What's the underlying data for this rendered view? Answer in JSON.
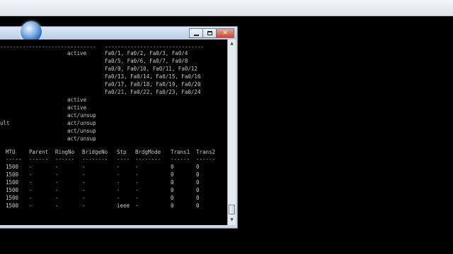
{
  "window": {
    "caption_close": "✕"
  },
  "console": {
    "dash_lines": [
      "-------------------------",
      "---------",
      "-------------------------------"
    ],
    "vlan_rows": [
      {
        "name": "",
        "status": "active",
        "ports": "Fa0/1, Fa0/2, Fa0/3, Fa0/4"
      },
      {
        "name": "",
        "status": "",
        "ports": "Fa0/5, Fa0/6, Fa0/7, Fa0/8"
      },
      {
        "name": "",
        "status": "",
        "ports": "Fa0/9, Fa0/10, Fa0/11, Fa0/12"
      },
      {
        "name": "",
        "status": "",
        "ports": "Fa0/13, Fa0/14, Fa0/15, Fa0/16"
      },
      {
        "name": "",
        "status": "",
        "ports": "Fa0/17, Fa0/18, Fa0/19, Fa0/20"
      },
      {
        "name": "",
        "status": "",
        "ports": "Fa0/21, Fa0/22, Fa0/23, Fa0/24"
      },
      {
        "name": "",
        "status": "active",
        "ports": ""
      },
      {
        "name": "",
        "status": "active",
        "ports": ""
      },
      {
        "name": "",
        "status": "act/unsup",
        "ports": ""
      },
      {
        "name": "ult",
        "status": "act/unsup",
        "ports": ""
      },
      {
        "name": "",
        "status": "act/unsup",
        "ports": ""
      },
      {
        "name": "",
        "status": "act/unsup",
        "ports": ""
      }
    ],
    "headers": [
      "MTU",
      "Parent",
      "RingNo",
      "BridgeNo",
      "Stp",
      "BrdgMode",
      "Trans1",
      "Trans2"
    ],
    "header_dashes": [
      "-----",
      "------",
      "------",
      "--------",
      "----",
      "--------",
      "------",
      "------"
    ],
    "rows": [
      [
        "1500",
        "-",
        "-",
        "-",
        "-",
        "-",
        "0",
        "0"
      ],
      [
        "1500",
        "-",
        "-",
        "-",
        "-",
        "-",
        "0",
        "0"
      ],
      [
        "1500",
        "-",
        "-",
        "-",
        "-",
        "-",
        "0",
        "0"
      ],
      [
        "1500",
        "-",
        "-",
        "-",
        "-",
        "-",
        "0",
        "0"
      ],
      [
        "1500",
        "-",
        "-",
        "-",
        "-",
        "-",
        "0",
        "0"
      ],
      [
        "1500",
        "-",
        "-",
        "-",
        "ieee",
        "-",
        "0",
        "0"
      ]
    ]
  },
  "scrollbar": {
    "up_arrow": "▲",
    "down_arrow": "▼"
  }
}
